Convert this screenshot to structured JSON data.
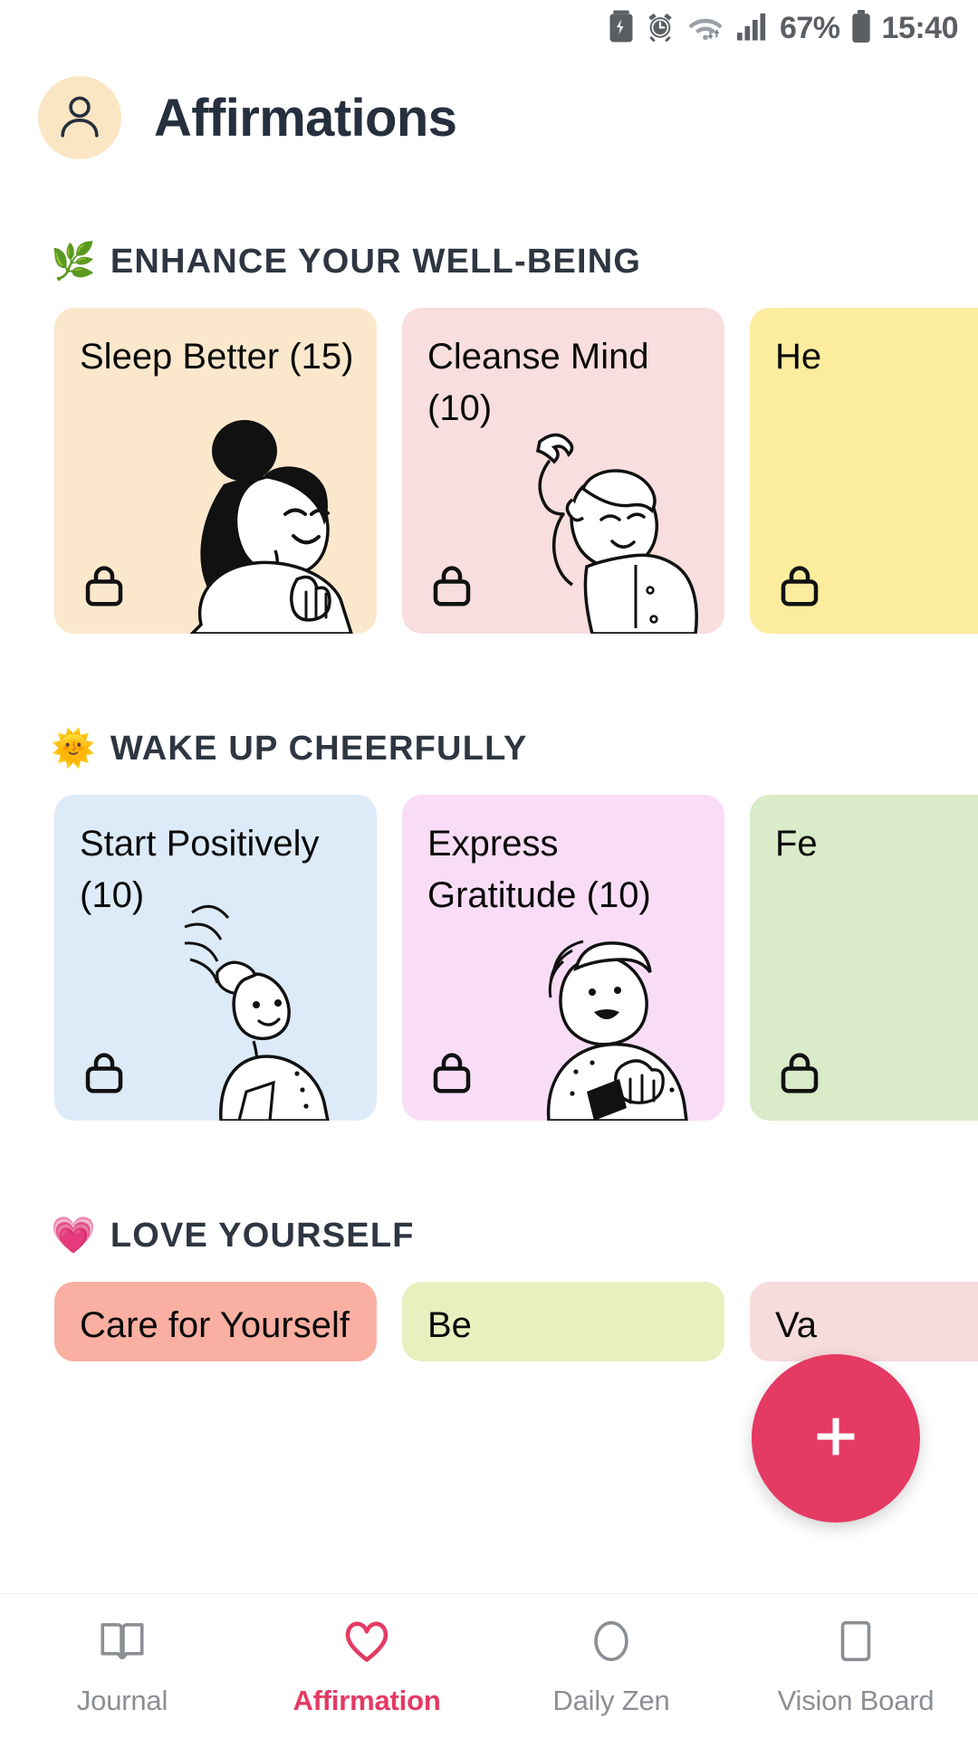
{
  "status_bar": {
    "icons": [
      "battery-saver-icon",
      "alarm-clock-icon",
      "wifi-icon",
      "cellular-signal-icon"
    ],
    "battery_percent": "67%",
    "battery_icon": "battery-icon",
    "time": "15:40"
  },
  "header": {
    "avatar_icon": "user-avatar-icon",
    "title": "Affirmations"
  },
  "theme": {
    "accent": "#E43A63",
    "title_color": "#262f3d",
    "muted": "#8b8f94",
    "avatar_bg": "#FBE6C3"
  },
  "sections": [
    {
      "emoji": "🌿",
      "emoji_name": "herb-icon",
      "title": "ENHANCE YOUR WELL-BEING",
      "cards": [
        {
          "title": "Sleep Better (15)",
          "color": "#FBE8CC",
          "locked": true,
          "art": "woman-bun-hand-chest"
        },
        {
          "title": "Cleanse Mind (10)",
          "color": "#F8DEDE",
          "locked": true,
          "art": "woman-towel-head"
        },
        {
          "title": "He",
          "color": "#FBEC9E",
          "locked": true,
          "art": "partial"
        }
      ]
    },
    {
      "emoji": "🌞",
      "emoji_name": "sun-with-face-icon",
      "title": "WAKE UP CHEERFULLY",
      "cards": [
        {
          "title": "Start Positively (10)",
          "color": "#DDEBF8",
          "locked": true,
          "art": "person-headband"
        },
        {
          "title": "Express Gratitude (10)",
          "color": "#F9DDF7",
          "locked": true,
          "art": "woman-hands-heart"
        },
        {
          "title": "Fe",
          "color": "#D9EBC8",
          "locked": true,
          "art": "partial"
        }
      ]
    },
    {
      "emoji": "💗",
      "emoji_name": "growing-heart-icon",
      "title": "LOVE YOURSELF",
      "cards": [
        {
          "title": "Care for Yourself",
          "color": "#F9AFA1",
          "locked": false,
          "art": "none"
        },
        {
          "title": "Be",
          "color": "#E9EFBE",
          "locked": false,
          "art": "none"
        },
        {
          "title": "Va",
          "color": "#F7DCDC",
          "locked": false,
          "art": "none"
        }
      ]
    }
  ],
  "fab": {
    "icon": "plus-icon",
    "label": "+"
  },
  "bottom_nav": {
    "items": [
      {
        "label": "Journal",
        "icon": "book-icon",
        "active": false
      },
      {
        "label": "Affirmation",
        "icon": "heart-icon",
        "active": true
      },
      {
        "label": "Daily Zen",
        "icon": "circle-icon",
        "active": false
      },
      {
        "label": "Vision Board",
        "icon": "square-icon",
        "active": false
      }
    ]
  }
}
